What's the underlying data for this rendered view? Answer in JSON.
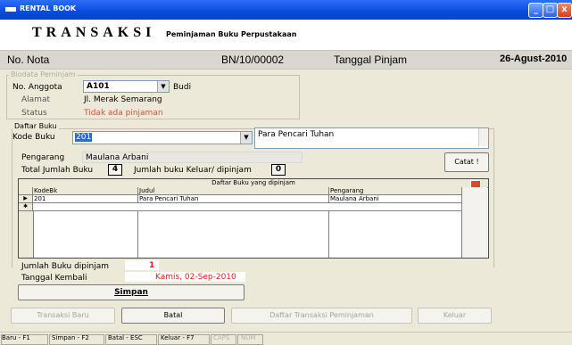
{
  "window": {
    "title": "RENTAL BOOK"
  },
  "header": {
    "title": "TRANSAKSI",
    "subtitle": "Peminjaman Buku Perpustakaan"
  },
  "nota": {
    "label": "No. Nota",
    "value": "BN/10/00002",
    "date_label": "Tanggal Pinjam",
    "date_value": "26-Agust-2010"
  },
  "biodata": {
    "legend": "Biodata Peminjam",
    "anggota_label": "No. Anggota",
    "anggota_value": "A101",
    "anggota_name": "Budi",
    "alamat_label": "Alamat",
    "alamat_value": "Jl. Merak Semarang",
    "status_label": "Status",
    "status_value": "Tidak ada pinjaman"
  },
  "daftar_buku": {
    "legend": "Daftar Buku",
    "kode_label": "Kode Buku",
    "kode_value": "201",
    "judul_value": "Para Pencari Tuhan",
    "pengarang_label": "Pengarang",
    "pengarang_value": "Maulana Arbani",
    "total_label": "Total Jumlah Buku",
    "total_value": "4",
    "keluar_label": "Jumlah buku Keluar/ dipinjam",
    "keluar_value": "0",
    "catat_label": "Catat !"
  },
  "grid": {
    "title": "Daftar Buku yang dipinjam",
    "columns": [
      "KodeBk",
      "Judul",
      "Pengarang"
    ],
    "rows": [
      [
        "201",
        "Para Pencari Tuhan",
        "Maulana Arbani"
      ]
    ],
    "row_markers": [
      "▶",
      "✱"
    ]
  },
  "summary": {
    "dipinjam_label": "Jumlah Buku dipinjam",
    "dipinjam_value": "1",
    "kembali_label": "Tanggal Kembali",
    "kembali_value": "Kamis, 02-Sep-2010",
    "simpan_label": "Simpan"
  },
  "actions": {
    "transaksi_baru": "Transaksi Baru",
    "batal": "Batal",
    "daftar_transaksi": "Daftar Transaksi Peminjaman",
    "keluar": "Keluar"
  },
  "statusbar": {
    "items": [
      "Baru - F1",
      "Simpan - F2",
      "Batal - ESC",
      "Keluar - F7",
      "CAPS",
      "NUM"
    ]
  },
  "colors": {
    "accent_red": "#e21c1c",
    "titlebar_blue": "#0a4be0"
  }
}
